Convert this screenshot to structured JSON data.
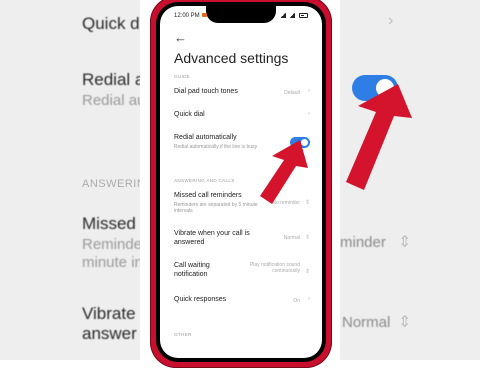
{
  "status_bar": {
    "time": "12:00 PM"
  },
  "header": {
    "back_icon": "back-arrow-icon",
    "title": "Advanced settings"
  },
  "sections": {
    "guide": "GUIDE",
    "answering": "ANSWERING AND CALLS",
    "other": "OTHER"
  },
  "settings": {
    "dial_pad": {
      "label": "Dial pad touch tones",
      "value": "Default"
    },
    "quick_dial": {
      "label": "Quick dial"
    },
    "redial": {
      "label": "Redial automatically",
      "desc": "Redial automatically if the line is busy",
      "enabled": true
    },
    "missed": {
      "label": "Missed call reminders",
      "desc": "Reminders are separated by 5 minute intervals",
      "value": "No reminder"
    },
    "vibrate": {
      "label": "Vibrate when your call is answered",
      "value": "Normal"
    },
    "waiting": {
      "label": "Call waiting notification",
      "value": "Play notification sound continuously"
    },
    "quick_resp": {
      "label": "Quick responses",
      "value": "On"
    }
  },
  "background": {
    "left": {
      "quick_dial": "Quick d",
      "redial": "Redial a",
      "redial_sub": "Redial au",
      "answering": "ANSWERIN",
      "missed": "Missed",
      "missed_sub1": "Reminder",
      "missed_sub2": "minute in",
      "vibrate": "Vibrate",
      "vibrate2": "answer"
    },
    "right": {
      "reminder": "minder",
      "normal": "Normal"
    }
  },
  "colors": {
    "accent": "#2f7ee6",
    "phone_frame": "#c8102e",
    "arrow": "#d3142c"
  }
}
